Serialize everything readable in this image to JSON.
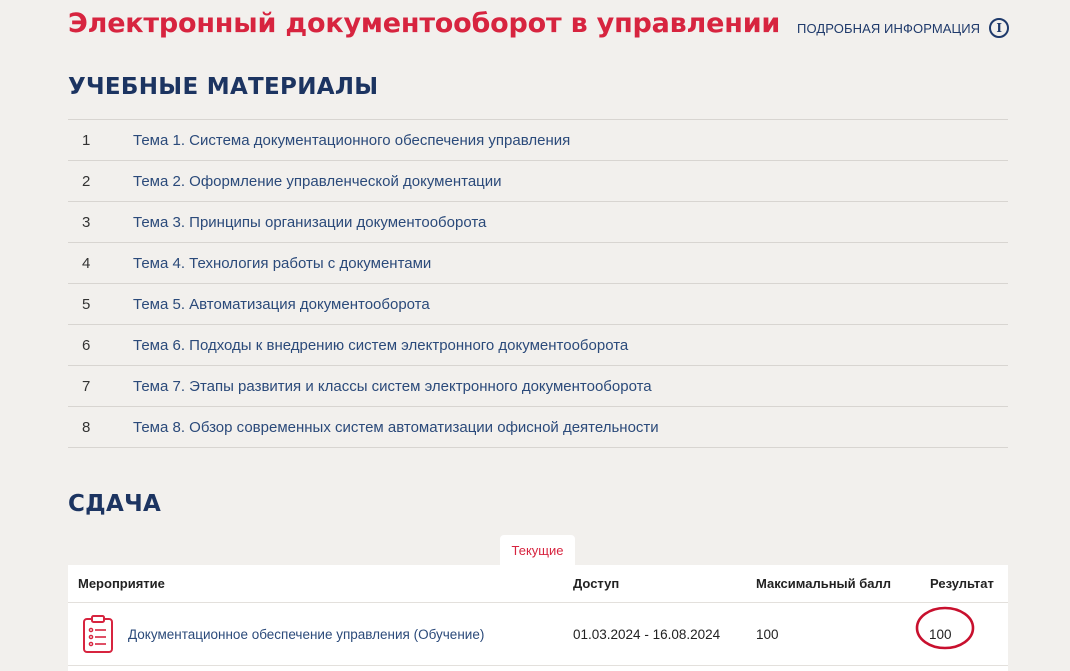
{
  "header": {
    "title": "Электронный документооборот в управлении",
    "info_label": "Подробная информация",
    "info_icon": "info-icon"
  },
  "materials": {
    "heading": "УЧЕБНЫЕ МАТЕРИАЛЫ",
    "items": [
      {
        "num": "1",
        "title": "Тема 1. Система документационного обеспечения управления"
      },
      {
        "num": "2",
        "title": "Тема 2. Оформление управленческой документации"
      },
      {
        "num": "3",
        "title": "Тема 3. Принципы организации документооборота"
      },
      {
        "num": "4",
        "title": "Тема 4. Технология работы с документами"
      },
      {
        "num": "5",
        "title": "Тема 5. Автоматизация документооборота"
      },
      {
        "num": "6",
        "title": "Тема 6. Подходы к внедрению систем электронного документооборота"
      },
      {
        "num": "7",
        "title": "Тема 7. Этапы развития и классы систем электронного документооборота"
      },
      {
        "num": "8",
        "title": "Тема 8. Обзор современных систем автоматизации офисной деятельности"
      }
    ]
  },
  "submission": {
    "heading": "СДАЧА",
    "tab_current": "Текущие",
    "columns": {
      "event": "Мероприятие",
      "access": "Доступ",
      "max_score": "Максимальный балл",
      "result": "Результат"
    },
    "rows": [
      {
        "icon": "clipboard-list-icon",
        "event": "Документационное обеспечение управления (Обучение)",
        "access": "01.03.2024 - 16.08.2024",
        "max_score": "100",
        "result": "100"
      }
    ]
  },
  "colors": {
    "accent_red": "#d7243f",
    "navy": "#1c3461",
    "link_blue": "#2b4a7a",
    "background": "#f2f0ed"
  }
}
